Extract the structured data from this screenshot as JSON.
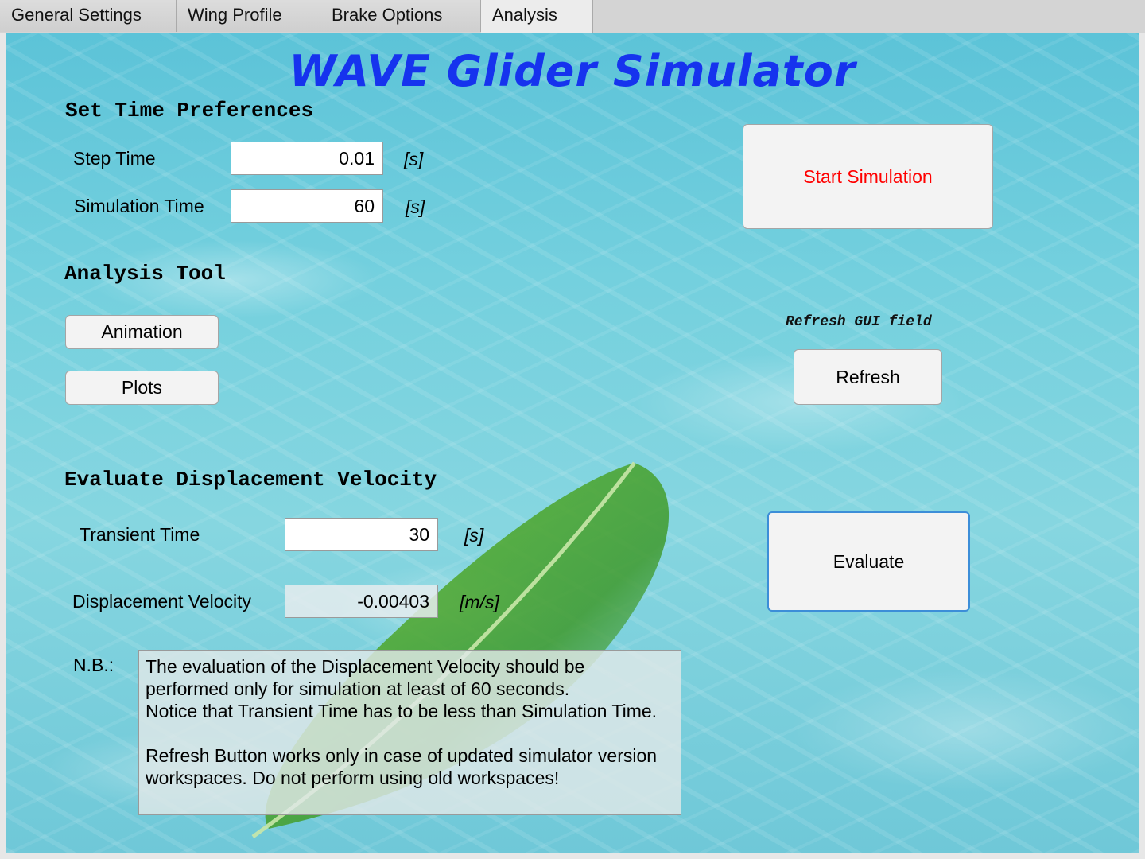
{
  "tabs": [
    {
      "label": "General Settings",
      "active": false
    },
    {
      "label": "Wing Profile",
      "active": false
    },
    {
      "label": "Brake Options",
      "active": false
    },
    {
      "label": "Analysis",
      "active": true
    }
  ],
  "title": "WAVE Glider Simulator",
  "time_prefs": {
    "heading": "Set Time Preferences",
    "step_time_label": "Step Time",
    "step_time_value": "0.01",
    "step_time_unit": "[s]",
    "sim_time_label": "Simulation Time",
    "sim_time_value": "60",
    "sim_time_unit": "[s]"
  },
  "start_button": "Start Simulation",
  "analysis": {
    "heading": "Analysis Tool",
    "animation_button": "Animation",
    "plots_button": "Plots"
  },
  "refresh": {
    "hint": "Refresh GUI field",
    "button": "Refresh"
  },
  "displacement": {
    "heading": "Evaluate Displacement Velocity",
    "transient_label": "Transient Time",
    "transient_value": "30",
    "transient_unit": "[s]",
    "velocity_label": "Displacement Velocity",
    "velocity_value": "-0.00403",
    "velocity_unit": "[m/s]",
    "evaluate_button": "Evaluate"
  },
  "note": {
    "label": "N.B.:",
    "line1": "The evaluation of the Displacement Velocity should be",
    "line2": "performed only for simulation at least of 60 seconds.",
    "line3": "Notice that Transient Time has to be less than Simulation Time.",
    "line4": "Refresh Button works only in case of updated simulator version",
    "line5": "workspaces. Do not perform using old workspaces!"
  },
  "colors": {
    "title": "#1633ee",
    "start_button_text": "#ff0000",
    "focus_border": "#3c8ed8"
  }
}
